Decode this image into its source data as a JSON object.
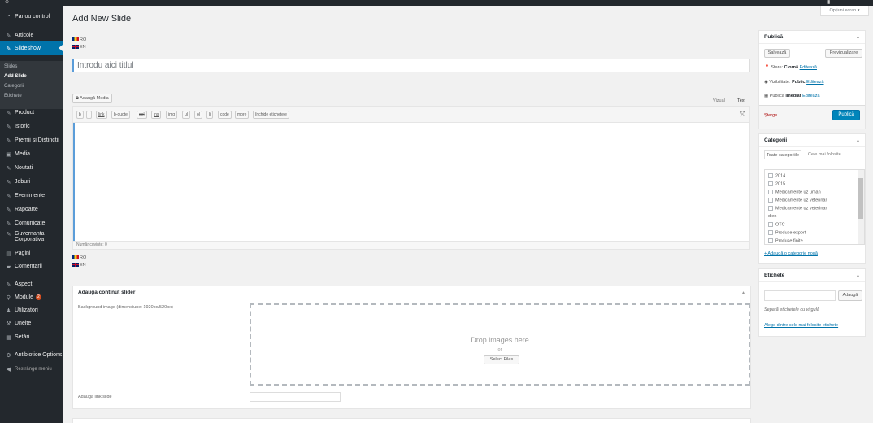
{
  "sidebar": {
    "items": [
      {
        "label": "Panou control",
        "icon": "dashboard-icon"
      },
      {
        "label": "Articole",
        "icon": "pin-icon"
      },
      {
        "label": "Slideshow",
        "icon": "pin-icon"
      },
      {
        "label": "Product",
        "icon": "pin-icon"
      },
      {
        "label": "Istoric",
        "icon": "pin-icon"
      },
      {
        "label": "Premii si Distinctii",
        "icon": "pin-icon"
      },
      {
        "label": "Media",
        "icon": "media-icon"
      },
      {
        "label": "Noutati",
        "icon": "pin-icon"
      },
      {
        "label": "Joburi",
        "icon": "pin-icon"
      },
      {
        "label": "Evenimente",
        "icon": "pin-icon"
      },
      {
        "label": "Rapoarte",
        "icon": "pin-icon"
      },
      {
        "label": "Comunicate",
        "icon": "pin-icon"
      },
      {
        "label": "Guvernanta",
        "label2": "Corporativa",
        "icon": "pin-icon"
      },
      {
        "label": "Pagini",
        "icon": "pages-icon"
      },
      {
        "label": "Comentarii",
        "icon": "comments-icon"
      },
      {
        "label": "Aspect",
        "icon": "appearance-icon"
      },
      {
        "label": "Module",
        "icon": "plugins-icon",
        "badge": "2"
      },
      {
        "label": "Utilizatori",
        "icon": "users-icon"
      },
      {
        "label": "Unelte",
        "icon": "tools-icon"
      },
      {
        "label": "Setări",
        "icon": "settings-icon"
      },
      {
        "label": "Antibiotice Options",
        "icon": "gear-icon"
      },
      {
        "label": "Restrânge meniu",
        "icon": "collapse-icon"
      }
    ],
    "submenu": [
      "Slides",
      "Add Slide",
      "Categorii",
      "Etichete"
    ]
  },
  "page": {
    "title": "Add New Slide",
    "screen_options": "Opțiuni ecran ▾",
    "languages": [
      "RO",
      "EN"
    ],
    "title_placeholder": "Introdu aici titlul"
  },
  "editor": {
    "add_media": "Adaugă Media",
    "tab_visual": "Vizual",
    "tab_text": "Text",
    "toolbar": [
      "b",
      "i",
      "link",
      "b-quote",
      "del",
      "ins",
      "img",
      "ul",
      "ol",
      "li",
      "code",
      "more",
      "închide etichetele"
    ],
    "word_count": "Număr cuvinte: 0"
  },
  "slider_box": {
    "title": "Adauga continut slider",
    "bg_label": "Background image (dimensiune: 1920px/520px)",
    "drop_text": "Drop images here",
    "or_text": "or",
    "select_files": "Select Files",
    "link_label": "Adauga link slide"
  },
  "publish": {
    "title": "Publică",
    "save_draft": "Salvează",
    "preview": "Previzualizare",
    "status_label": "Stare:",
    "status_value": "Ciornă",
    "visibility_label": "Vizibilitate:",
    "visibility_value": "Public",
    "publish_label": "Publică",
    "publish_value": "imediat",
    "edit": "Editează",
    "delete": "Șterge",
    "publish_button": "Publică"
  },
  "categories": {
    "title": "Categorii",
    "tab_all": "Toate categoriile",
    "tab_popular": "Cele mai folosite",
    "items": [
      "2014",
      "2015",
      "Medicamente uz uman",
      "Medicamente uz veterinar",
      "Medicamente uz veterinar",
      "OTC",
      "Produse export",
      "Produse finite"
    ],
    "wrap_text": "dien",
    "add_new": "+ Adaugă o categorie nouă"
  },
  "tags": {
    "title": "Etichete",
    "add_button": "Adaugă",
    "hint": "Separă etichetele cu virgulă",
    "choose_popular": "Alege dintre cele mai folosite etichete"
  }
}
